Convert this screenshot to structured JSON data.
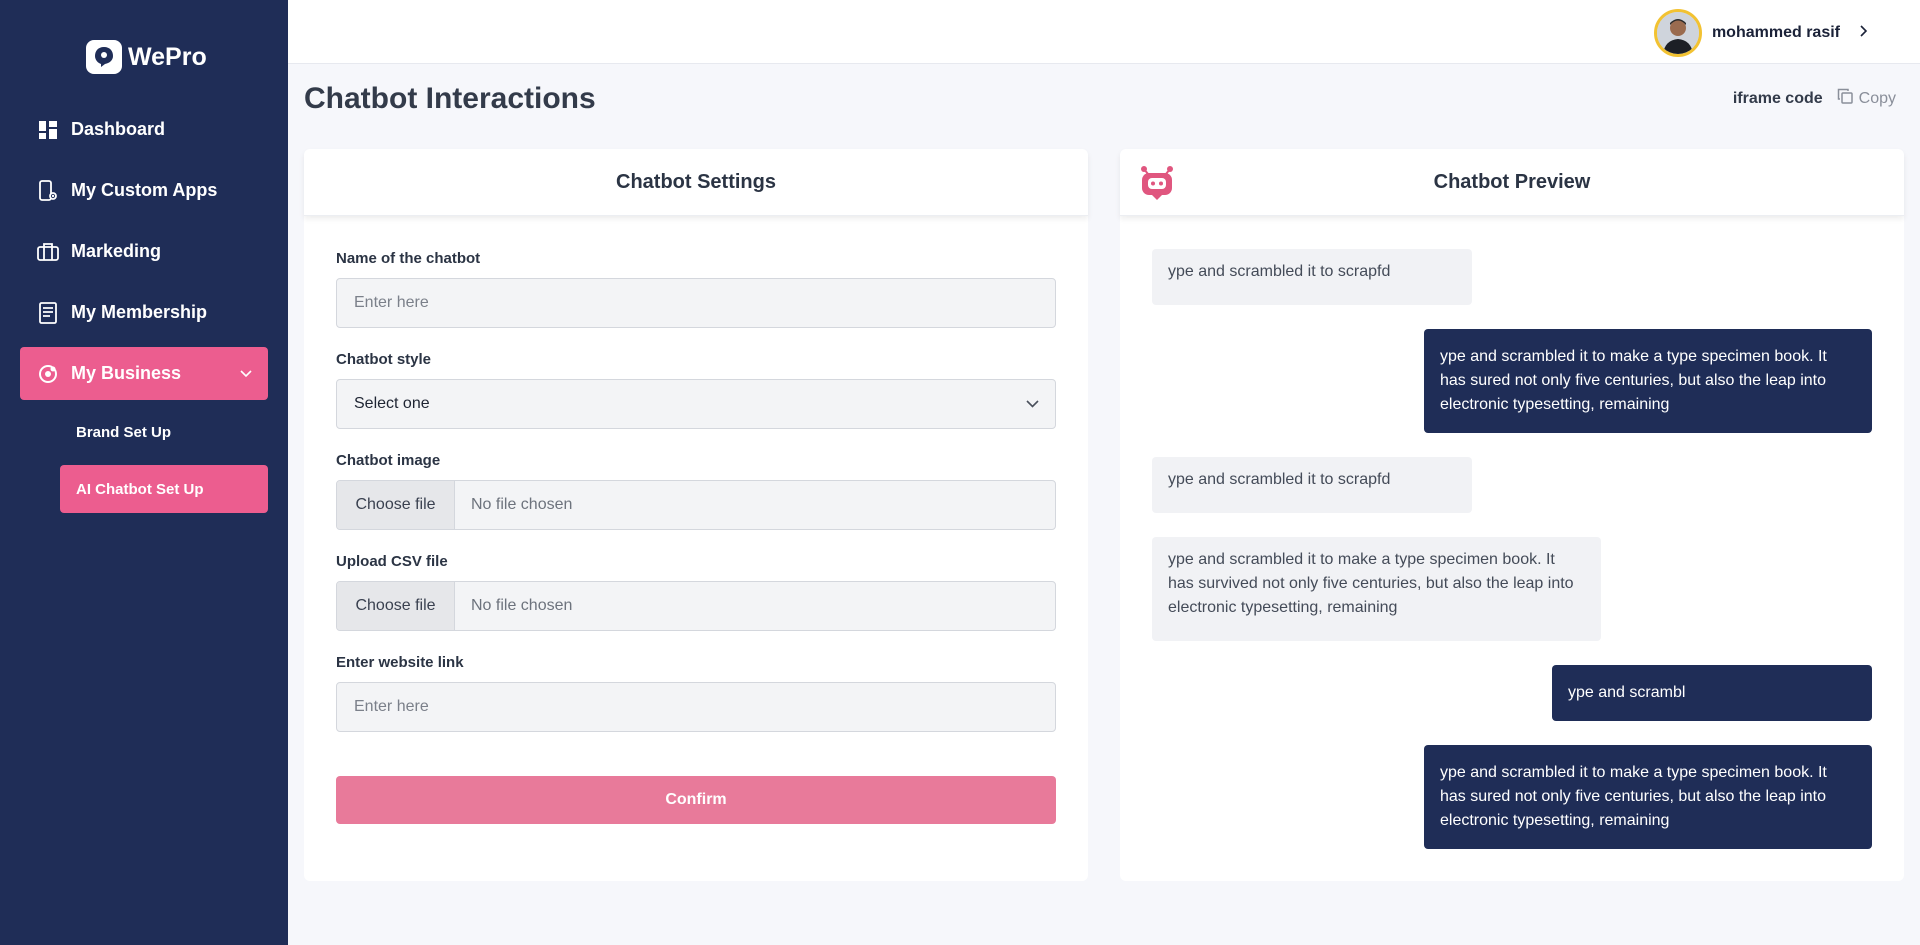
{
  "app": {
    "brand": "WePro"
  },
  "sidebar": {
    "items": [
      {
        "label": "Dashboard",
        "icon": "dashboard-icon"
      },
      {
        "label": "My Custom Apps",
        "icon": "phone-settings-icon"
      },
      {
        "label": "Markeding",
        "icon": "briefcase-icon"
      },
      {
        "label": "My Membership",
        "icon": "document-icon"
      },
      {
        "label": "My Business",
        "icon": "business-icon",
        "active": true
      }
    ],
    "subitems": [
      {
        "label": "Brand Set Up"
      },
      {
        "label": "AI Chatbot Set Up",
        "active": true
      }
    ]
  },
  "topbar": {
    "user_name": "mohammed rasif"
  },
  "page": {
    "title": "Chatbot Interactions",
    "iframe_label": "iframe code",
    "copy_label": "Copy"
  },
  "settings": {
    "title": "Chatbot Settings",
    "name_label": "Name of the chatbot",
    "name_placeholder": "Enter here",
    "style_label": "Chatbot style",
    "style_value": "Select one",
    "image_label": "Chatbot image",
    "image_button": "Choose file",
    "image_status": "No file chosen",
    "csv_label": "Upload CSV file",
    "csv_button": "Choose file",
    "csv_status": "No file chosen",
    "website_label": "Enter website link",
    "website_placeholder": "Enter here",
    "confirm_label": "Confirm"
  },
  "preview": {
    "title": "Chatbot Preview",
    "messages": [
      {
        "from": "bot",
        "text": "ype and scrambled it to scrapfd"
      },
      {
        "from": "user",
        "text": "ype and scrambled it to make a type specimen book. It has sured not only five centuries, but also the leap into electronic typesetting, remaining"
      },
      {
        "from": "bot",
        "text": "ype and scrambled it to scrapfd"
      },
      {
        "from": "bot",
        "text": "ype and scrambled it to make a type specimen book. It has survived not only five centuries, but also the leap into electronic typesetting, remaining"
      },
      {
        "from": "user",
        "text": "ype and scrambl"
      },
      {
        "from": "user",
        "text": "ype and scrambled it to make a type specimen book. It has sured not only five centuries, but also the leap into electronic typesetting, remaining"
      }
    ]
  },
  "colors": {
    "sidebar": "#1f2d57",
    "accent": "#ec5d8f",
    "confirm": "#e87a9a",
    "user_bubble": "#1f2d57",
    "bot_bubble": "#f1f2f5"
  }
}
